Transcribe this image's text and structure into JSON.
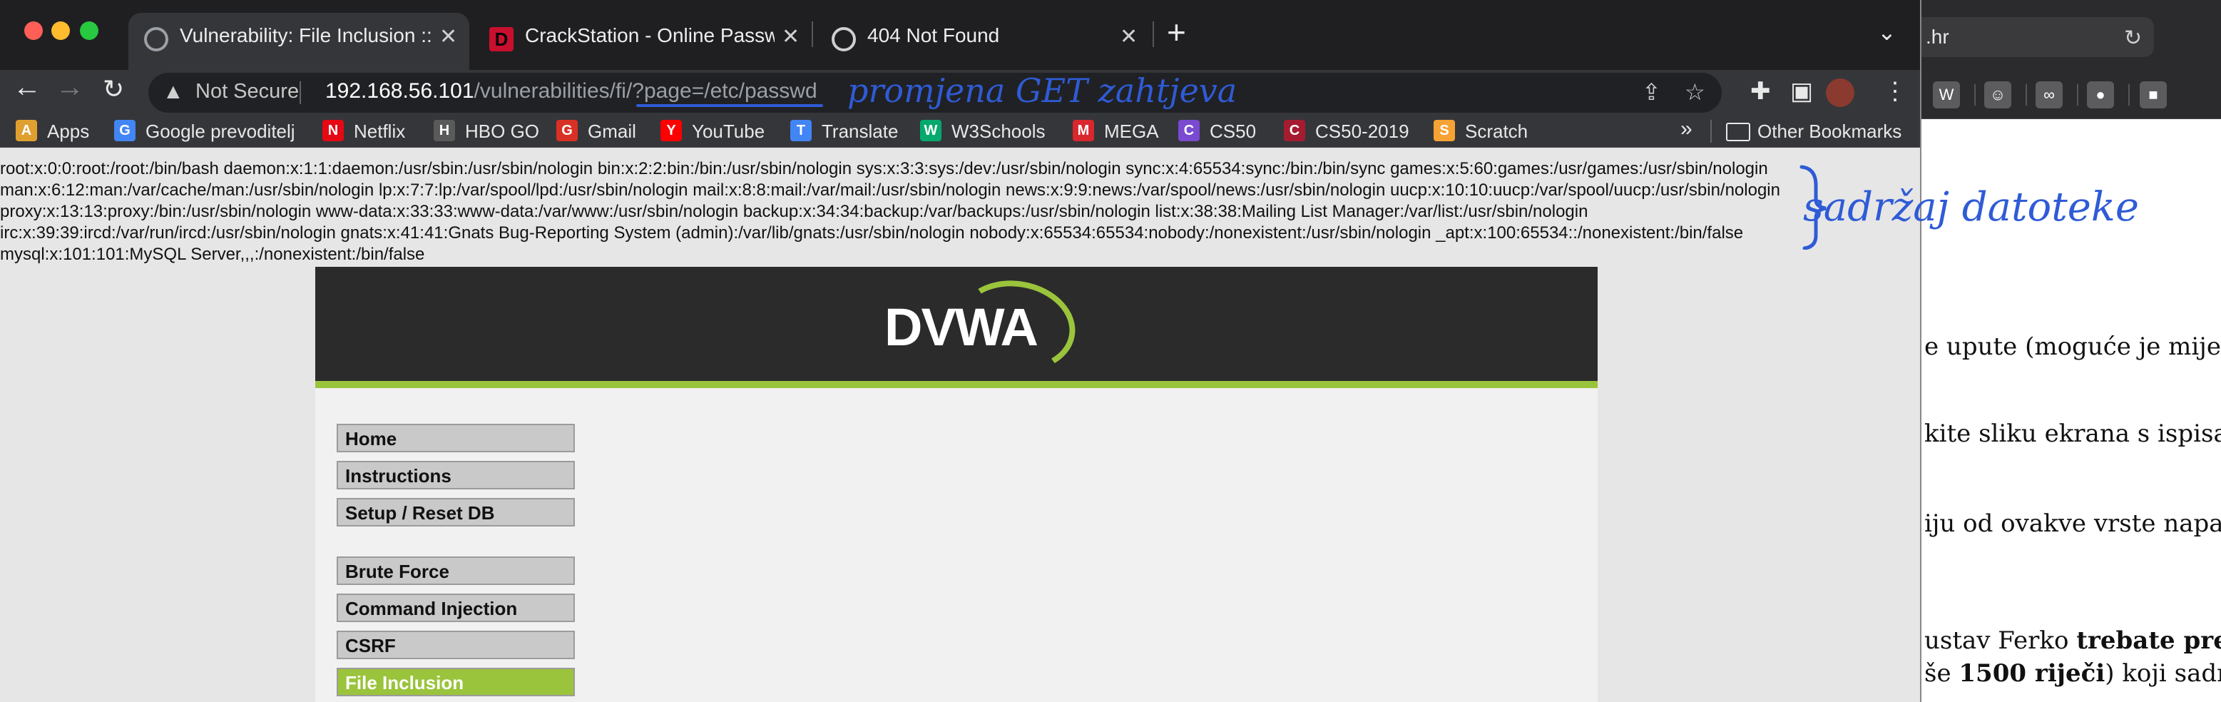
{
  "bg_window": {
    "url_fragment": ".hr",
    "doc_lines": [
      {
        "pre": "e upute (moguće je mijenj",
        "bold": "",
        "post": ""
      },
      {
        "pre": "kite sliku ekrana s ispisanc",
        "bold": "",
        "post": ""
      },
      {
        "pre": "iju od ovakve vrste napada",
        "bold": "",
        "post": ""
      },
      {
        "pre": "ustav Ferko ",
        "bold": "trebate preda",
        "post": ""
      },
      {
        "pre": "še ",
        "bold": "1500 riječi",
        "post": ") koji sadrži"
      }
    ]
  },
  "annotations": {
    "url_note": "promjena GET zahtjeva",
    "content_note": "sadržaj datoteke"
  },
  "browser": {
    "tabs": [
      {
        "title": "Vulnerability: File Inclusion :: Da",
        "icon": "dvwa-tab-icon"
      },
      {
        "title": "CrackStation - Online Passwo",
        "icon": "crackstation-icon"
      },
      {
        "title": "404 Not Found",
        "icon": "globe-icon"
      }
    ],
    "address": {
      "security_label": "Not Secure",
      "host": "192.168.56.101",
      "path": "/vulnerabilities/fi/?page=/etc/passwd"
    },
    "bookmarks": [
      {
        "label": "Apps",
        "icon": "apps-grid-icon",
        "color": "#e0a030"
      },
      {
        "label": "Google prevoditelj",
        "icon": "google-translate-icon",
        "color": "#4285f4"
      },
      {
        "label": "Netflix",
        "icon": "netflix-icon",
        "color": "#e50914"
      },
      {
        "label": "HBO GO",
        "icon": "hbo-icon",
        "color": "#5a5a5a"
      },
      {
        "label": "Gmail",
        "icon": "gmail-icon",
        "color": "#d93025"
      },
      {
        "label": "YouTube",
        "icon": "youtube-icon",
        "color": "#ff0000"
      },
      {
        "label": "Translate",
        "icon": "translate-icon",
        "color": "#4285f4"
      },
      {
        "label": "W3Schools",
        "icon": "w3schools-icon",
        "color": "#04aa6d"
      },
      {
        "label": "MEGA",
        "icon": "mega-icon",
        "color": "#d9272e"
      },
      {
        "label": "CS50",
        "icon": "edx-icon",
        "color": "#7a4ad0"
      },
      {
        "label": "CS50-2019",
        "icon": "harvard-icon",
        "color": "#a51c30"
      },
      {
        "label": "Scratch",
        "icon": "scratch-icon",
        "color": "#f7a234"
      }
    ],
    "other_bookmarks": "Other Bookmarks"
  },
  "passwd_lines": [
    "root:x:0:0:root:/root:/bin/bash daemon:x:1:1:daemon:/usr/sbin:/usr/sbin/nologin bin:x:2:2:bin:/bin:/usr/sbin/nologin sys:x:3:3:sys:/dev:/usr/sbin/nologin sync:x:4:65534:sync:/bin:/bin/sync games:x:5:60:games:/usr/games:/usr/sbin/nologin",
    "man:x:6:12:man:/var/cache/man:/usr/sbin/nologin lp:x:7:7:lp:/var/spool/lpd:/usr/sbin/nologin mail:x:8:8:mail:/var/mail:/usr/sbin/nologin news:x:9:9:news:/var/spool/news:/usr/sbin/nologin uucp:x:10:10:uucp:/var/spool/uucp:/usr/sbin/nologin",
    "proxy:x:13:13:proxy:/bin:/usr/sbin/nologin www-data:x:33:33:www-data:/var/www:/usr/sbin/nologin backup:x:34:34:backup:/var/backups:/usr/sbin/nologin list:x:38:38:Mailing List Manager:/var/list:/usr/sbin/nologin",
    "irc:x:39:39:ircd:/var/run/ircd:/usr/sbin/nologin gnats:x:41:41:Gnats Bug-Reporting System (admin):/var/lib/gnats:/usr/sbin/nologin nobody:x:65534:65534:nobody:/nonexistent:/usr/sbin/nologin _apt:x:100:65534::/nonexistent:/bin/false",
    "mysql:x:101:101:MySQL Server,,,:/nonexistent:/bin/false"
  ],
  "dvwa": {
    "logo": "DVWA",
    "menu_group1": [
      "Home",
      "Instructions",
      "Setup / Reset DB"
    ],
    "menu_group2": [
      "Brute Force",
      "Command Injection",
      "CSRF",
      "File Inclusion"
    ],
    "selected": "File Inclusion",
    "accent": "#9ac43c"
  }
}
